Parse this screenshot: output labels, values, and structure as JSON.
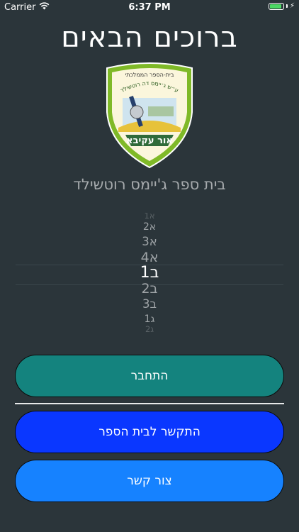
{
  "status_bar": {
    "carrier": "Carrier",
    "time": "6:37 PM",
    "battery_level": 0.9
  },
  "header": {
    "title": "ברוכים הבאים"
  },
  "logo": {
    "top_text": "בית-הספר הממלכתי",
    "arc_text": "ע״ש ג׳יימס דה רוטשילד",
    "bottom_text": "אור עקיבא"
  },
  "school_name": "בית ספר ג'יימס רוטשילד",
  "picker": {
    "items": [
      "1א",
      "א2",
      "א3",
      "א4",
      "ב1",
      "ב2",
      "ב3",
      "ג1",
      "ג2"
    ],
    "selected_index": 4
  },
  "buttons": {
    "connect": "התחבר",
    "contact_school": "התקשר לבית הספר",
    "contact": "צור קשר"
  },
  "colors": {
    "background": "#2b353a",
    "connect_button": "#14837e",
    "contact_school_button": "#0a37ff",
    "contact_button": "#1682ff",
    "logo_border": "#7fb927"
  }
}
